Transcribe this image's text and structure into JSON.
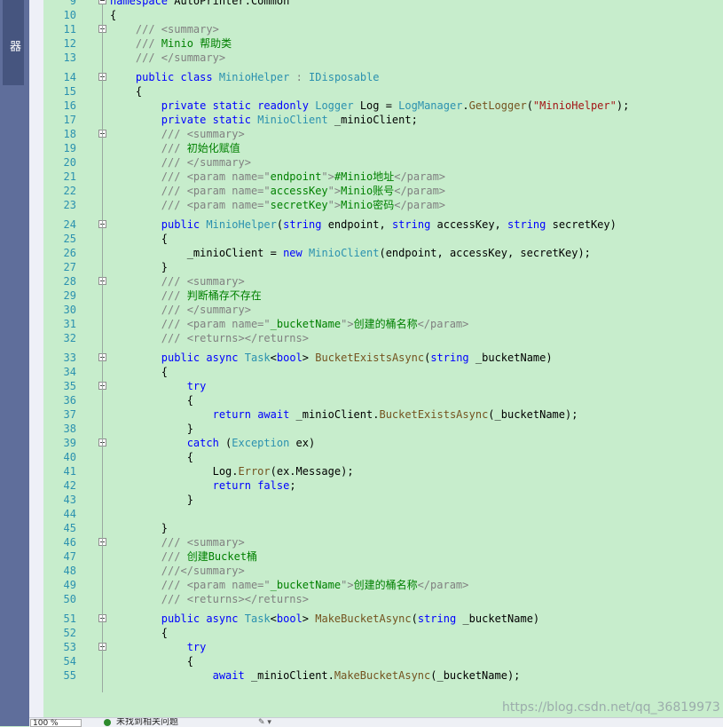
{
  "side_panel": {
    "title": "测试资源管理器"
  },
  "editor": {
    "lines": [
      {
        "n": "9",
        "fold": true,
        "parts": [
          [
            "kw",
            "namespace"
          ],
          [
            "pl",
            " AutoPrinter.Common"
          ]
        ]
      },
      {
        "n": "10",
        "fold": false,
        "parts": [
          [
            "pl",
            "{"
          ]
        ]
      },
      {
        "n": "11",
        "fold": true,
        "parts": [
          [
            "pl",
            "    "
          ],
          [
            "xt",
            "/// <summary>"
          ]
        ]
      },
      {
        "n": "12",
        "fold": false,
        "parts": [
          [
            "pl",
            "    "
          ],
          [
            "xt",
            "///"
          ],
          [
            "cm",
            " Minio 帮助类"
          ]
        ]
      },
      {
        "n": "13",
        "fold": false,
        "parts": [
          [
            "pl",
            "    "
          ],
          [
            "xt",
            "/// </summary>"
          ]
        ]
      },
      {
        "n": "14",
        "fold": true,
        "parts": [
          [
            "pl",
            "    "
          ],
          [
            "kw",
            "public"
          ],
          [
            "pl",
            " "
          ],
          [
            "kw",
            "class"
          ],
          [
            "pl",
            " "
          ],
          [
            "ty",
            "MinioHelper"
          ],
          [
            "pl",
            " "
          ],
          [
            "xt",
            ":"
          ],
          [
            "pl",
            " "
          ],
          [
            "ty",
            "IDisposable"
          ]
        ]
      },
      {
        "n": "15",
        "fold": false,
        "parts": [
          [
            "pl",
            "    {"
          ]
        ]
      },
      {
        "n": "16",
        "fold": false,
        "parts": [
          [
            "pl",
            "        "
          ],
          [
            "kw",
            "private"
          ],
          [
            "pl",
            " "
          ],
          [
            "kw",
            "static"
          ],
          [
            "pl",
            " "
          ],
          [
            "kw",
            "readonly"
          ],
          [
            "pl",
            " "
          ],
          [
            "ty",
            "Logger"
          ],
          [
            "pl",
            " Log = "
          ],
          [
            "ty",
            "LogManager"
          ],
          [
            "pl",
            "."
          ],
          [
            "fn",
            "GetLogger"
          ],
          [
            "pl",
            "("
          ],
          [
            "str",
            "\"MinioHelper\""
          ],
          [
            "pl",
            ");"
          ]
        ]
      },
      {
        "n": "17",
        "fold": false,
        "parts": [
          [
            "pl",
            "        "
          ],
          [
            "kw",
            "private"
          ],
          [
            "pl",
            " "
          ],
          [
            "kw",
            "static"
          ],
          [
            "pl",
            " "
          ],
          [
            "ty",
            "MinioClient"
          ],
          [
            "pl",
            " _minioClient;"
          ]
        ]
      },
      {
        "n": "18",
        "fold": true,
        "parts": [
          [
            "pl",
            "        "
          ],
          [
            "xt",
            "/// <summary>"
          ]
        ]
      },
      {
        "n": "19",
        "fold": false,
        "parts": [
          [
            "pl",
            "        "
          ],
          [
            "xt",
            "///"
          ],
          [
            "cm",
            " 初始化赋值"
          ]
        ]
      },
      {
        "n": "20",
        "fold": false,
        "parts": [
          [
            "pl",
            "        "
          ],
          [
            "xt",
            "/// </summary>"
          ]
        ]
      },
      {
        "n": "21",
        "fold": false,
        "parts": [
          [
            "pl",
            "        "
          ],
          [
            "xt",
            "/// <param name=\""
          ],
          [
            "cm",
            "endpoint"
          ],
          [
            "xt",
            "\">"
          ],
          [
            "cm",
            "#Minio地址"
          ],
          [
            "xt",
            "</param>"
          ]
        ]
      },
      {
        "n": "22",
        "fold": false,
        "parts": [
          [
            "pl",
            "        "
          ],
          [
            "xt",
            "/// <param name=\""
          ],
          [
            "cm",
            "accessKey"
          ],
          [
            "xt",
            "\">"
          ],
          [
            "cm",
            "Minio账号"
          ],
          [
            "xt",
            "</param>"
          ]
        ]
      },
      {
        "n": "23",
        "fold": false,
        "parts": [
          [
            "pl",
            "        "
          ],
          [
            "xt",
            "/// <param name=\""
          ],
          [
            "cm",
            "secretKey"
          ],
          [
            "xt",
            "\">"
          ],
          [
            "cm",
            "Minio密码"
          ],
          [
            "xt",
            "</param>"
          ]
        ]
      },
      {
        "n": "24",
        "fold": true,
        "parts": [
          [
            "pl",
            "        "
          ],
          [
            "kw",
            "public"
          ],
          [
            "pl",
            " "
          ],
          [
            "ty",
            "MinioHelper"
          ],
          [
            "pl",
            "("
          ],
          [
            "kw",
            "string"
          ],
          [
            "pl",
            " endpoint, "
          ],
          [
            "kw",
            "string"
          ],
          [
            "pl",
            " accessKey, "
          ],
          [
            "kw",
            "string"
          ],
          [
            "pl",
            " secretKey)"
          ]
        ]
      },
      {
        "n": "25",
        "fold": false,
        "parts": [
          [
            "pl",
            "        {"
          ]
        ]
      },
      {
        "n": "26",
        "fold": false,
        "parts": [
          [
            "pl",
            "            _minioClient = "
          ],
          [
            "kw",
            "new"
          ],
          [
            "pl",
            " "
          ],
          [
            "ty",
            "MinioClient"
          ],
          [
            "pl",
            "(endpoint, accessKey, secretKey);"
          ]
        ]
      },
      {
        "n": "27",
        "fold": false,
        "parts": [
          [
            "pl",
            "        }"
          ]
        ]
      },
      {
        "n": "28",
        "fold": true,
        "parts": [
          [
            "pl",
            "        "
          ],
          [
            "xt",
            "/// <summary>"
          ]
        ]
      },
      {
        "n": "29",
        "fold": false,
        "parts": [
          [
            "pl",
            "        "
          ],
          [
            "xt",
            "///"
          ],
          [
            "cm",
            " 判断桶存不存在"
          ]
        ]
      },
      {
        "n": "30",
        "fold": false,
        "parts": [
          [
            "pl",
            "        "
          ],
          [
            "xt",
            "/// </summary>"
          ]
        ]
      },
      {
        "n": "31",
        "fold": false,
        "parts": [
          [
            "pl",
            "        "
          ],
          [
            "xt",
            "/// <param name=\""
          ],
          [
            "cm",
            "_bucketName"
          ],
          [
            "xt",
            "\">"
          ],
          [
            "cm",
            "创建的桶名称"
          ],
          [
            "xt",
            "</param>"
          ]
        ]
      },
      {
        "n": "32",
        "fold": false,
        "parts": [
          [
            "pl",
            "        "
          ],
          [
            "xt",
            "/// <returns></returns>"
          ]
        ]
      },
      {
        "n": "33",
        "fold": true,
        "parts": [
          [
            "pl",
            "        "
          ],
          [
            "kw",
            "public"
          ],
          [
            "pl",
            " "
          ],
          [
            "kw",
            "async"
          ],
          [
            "pl",
            " "
          ],
          [
            "ty",
            "Task"
          ],
          [
            "pl",
            "<"
          ],
          [
            "kw",
            "bool"
          ],
          [
            "pl",
            "> "
          ],
          [
            "fn",
            "BucketExistsAsync"
          ],
          [
            "pl",
            "("
          ],
          [
            "kw",
            "string"
          ],
          [
            "pl",
            " _bucketName)"
          ]
        ]
      },
      {
        "n": "34",
        "fold": false,
        "parts": [
          [
            "pl",
            "        {"
          ]
        ]
      },
      {
        "n": "35",
        "fold": true,
        "parts": [
          [
            "pl",
            "            "
          ],
          [
            "kw",
            "try"
          ]
        ]
      },
      {
        "n": "36",
        "fold": false,
        "parts": [
          [
            "pl",
            "            {"
          ]
        ]
      },
      {
        "n": "37",
        "fold": false,
        "parts": [
          [
            "pl",
            "                "
          ],
          [
            "kw",
            "return"
          ],
          [
            "pl",
            " "
          ],
          [
            "kw",
            "await"
          ],
          [
            "pl",
            " _minioClient."
          ],
          [
            "fn",
            "BucketExistsAsync"
          ],
          [
            "pl",
            "(_bucketName);"
          ]
        ]
      },
      {
        "n": "38",
        "fold": false,
        "parts": [
          [
            "pl",
            "            }"
          ]
        ]
      },
      {
        "n": "39",
        "fold": true,
        "parts": [
          [
            "pl",
            "            "
          ],
          [
            "kw",
            "catch"
          ],
          [
            "pl",
            " ("
          ],
          [
            "ty",
            "Exception"
          ],
          [
            "pl",
            " ex)"
          ]
        ]
      },
      {
        "n": "40",
        "fold": false,
        "parts": [
          [
            "pl",
            "            {"
          ]
        ]
      },
      {
        "n": "41",
        "fold": false,
        "parts": [
          [
            "pl",
            "                Log."
          ],
          [
            "fn",
            "Error"
          ],
          [
            "pl",
            "(ex.Message);"
          ]
        ]
      },
      {
        "n": "42",
        "fold": false,
        "parts": [
          [
            "pl",
            "                "
          ],
          [
            "kw",
            "return"
          ],
          [
            "pl",
            " "
          ],
          [
            "kw",
            "false"
          ],
          [
            "pl",
            ";"
          ]
        ]
      },
      {
        "n": "43",
        "fold": false,
        "parts": [
          [
            "pl",
            "            }"
          ]
        ]
      },
      {
        "n": "44",
        "fold": false,
        "parts": []
      },
      {
        "n": "45",
        "fold": false,
        "parts": [
          [
            "pl",
            "        }"
          ]
        ]
      },
      {
        "n": "46",
        "fold": true,
        "parts": [
          [
            "pl",
            "        "
          ],
          [
            "xt",
            "/// <summary>"
          ]
        ]
      },
      {
        "n": "47",
        "fold": false,
        "parts": [
          [
            "pl",
            "        "
          ],
          [
            "xt",
            "///"
          ],
          [
            "cm",
            " 创建Bucket桶"
          ]
        ]
      },
      {
        "n": "48",
        "fold": false,
        "parts": [
          [
            "pl",
            "        "
          ],
          [
            "xt",
            "///</summary>"
          ]
        ]
      },
      {
        "n": "49",
        "fold": false,
        "parts": [
          [
            "pl",
            "        "
          ],
          [
            "xt",
            "/// <param name=\""
          ],
          [
            "cm",
            "_bucketName"
          ],
          [
            "xt",
            "\">"
          ],
          [
            "cm",
            "创建的桶名称"
          ],
          [
            "xt",
            "</param>"
          ]
        ]
      },
      {
        "n": "50",
        "fold": false,
        "parts": [
          [
            "pl",
            "        "
          ],
          [
            "xt",
            "/// <returns></returns>"
          ]
        ]
      },
      {
        "n": "51",
        "fold": true,
        "parts": [
          [
            "pl",
            "        "
          ],
          [
            "kw",
            "public"
          ],
          [
            "pl",
            " "
          ],
          [
            "kw",
            "async"
          ],
          [
            "pl",
            " "
          ],
          [
            "ty",
            "Task"
          ],
          [
            "pl",
            "<"
          ],
          [
            "kw",
            "bool"
          ],
          [
            "pl",
            "> "
          ],
          [
            "fn",
            "MakeBucketAsync"
          ],
          [
            "pl",
            "("
          ],
          [
            "kw",
            "string"
          ],
          [
            "pl",
            " _bucketName)"
          ]
        ]
      },
      {
        "n": "52",
        "fold": false,
        "parts": [
          [
            "pl",
            "        {"
          ]
        ]
      },
      {
        "n": "53",
        "fold": true,
        "parts": [
          [
            "pl",
            "            "
          ],
          [
            "kw",
            "try"
          ]
        ]
      },
      {
        "n": "54",
        "fold": false,
        "parts": [
          [
            "pl",
            "            {"
          ]
        ]
      },
      {
        "n": "55",
        "fold": false,
        "parts": [
          [
            "pl",
            "                "
          ],
          [
            "kw",
            "await"
          ],
          [
            "pl",
            " _minioClient."
          ],
          [
            "fn",
            "MakeBucketAsync"
          ],
          [
            "pl",
            "(_bucketName);"
          ]
        ]
      }
    ]
  },
  "status_bar": {
    "zoom": "100 %",
    "issues_text": "未找到相关问题",
    "brush_glyph": "✎ ▾"
  },
  "watermark": "https://blog.csdn.net/qq_36819973",
  "colors": {
    "background": "#c7edcc",
    "keyword": "#0000ff",
    "type": "#2b91af",
    "string": "#a31515",
    "comment": "#008000",
    "xmldoc": "#808080"
  }
}
